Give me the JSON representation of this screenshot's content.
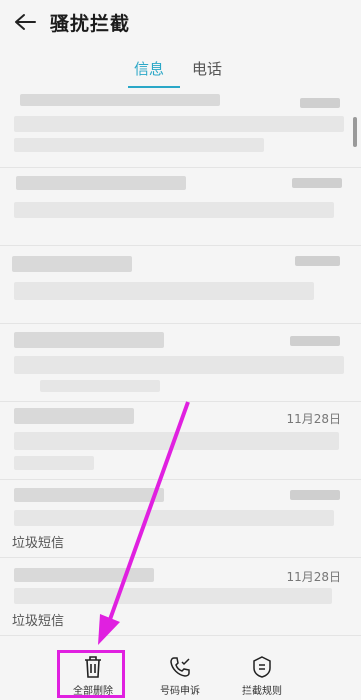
{
  "header": {
    "title": "骚扰拦截",
    "back_icon": "back-arrow-icon"
  },
  "tabs": [
    {
      "label": "信息",
      "active": true
    },
    {
      "label": "电话",
      "active": false
    }
  ],
  "messages": [
    {
      "date": "",
      "tag": ""
    },
    {
      "date": "",
      "tag": ""
    },
    {
      "date": "",
      "tag": ""
    },
    {
      "date": "",
      "tag": ""
    },
    {
      "date": "11月28日",
      "tag": ""
    },
    {
      "date": "",
      "tag": "垃圾短信"
    },
    {
      "date": "11月28日",
      "tag": "垃圾短信"
    }
  ],
  "bottom_bar": {
    "delete_all": {
      "label": "全部删除",
      "icon": "trash-icon"
    },
    "appeal": {
      "label": "号码申诉",
      "icon": "phone-check-icon"
    },
    "rules": {
      "label": "拦截规则",
      "icon": "shield-rules-icon"
    }
  },
  "colors": {
    "accent": "#2aa7c7",
    "annotation": "#e020e0"
  }
}
